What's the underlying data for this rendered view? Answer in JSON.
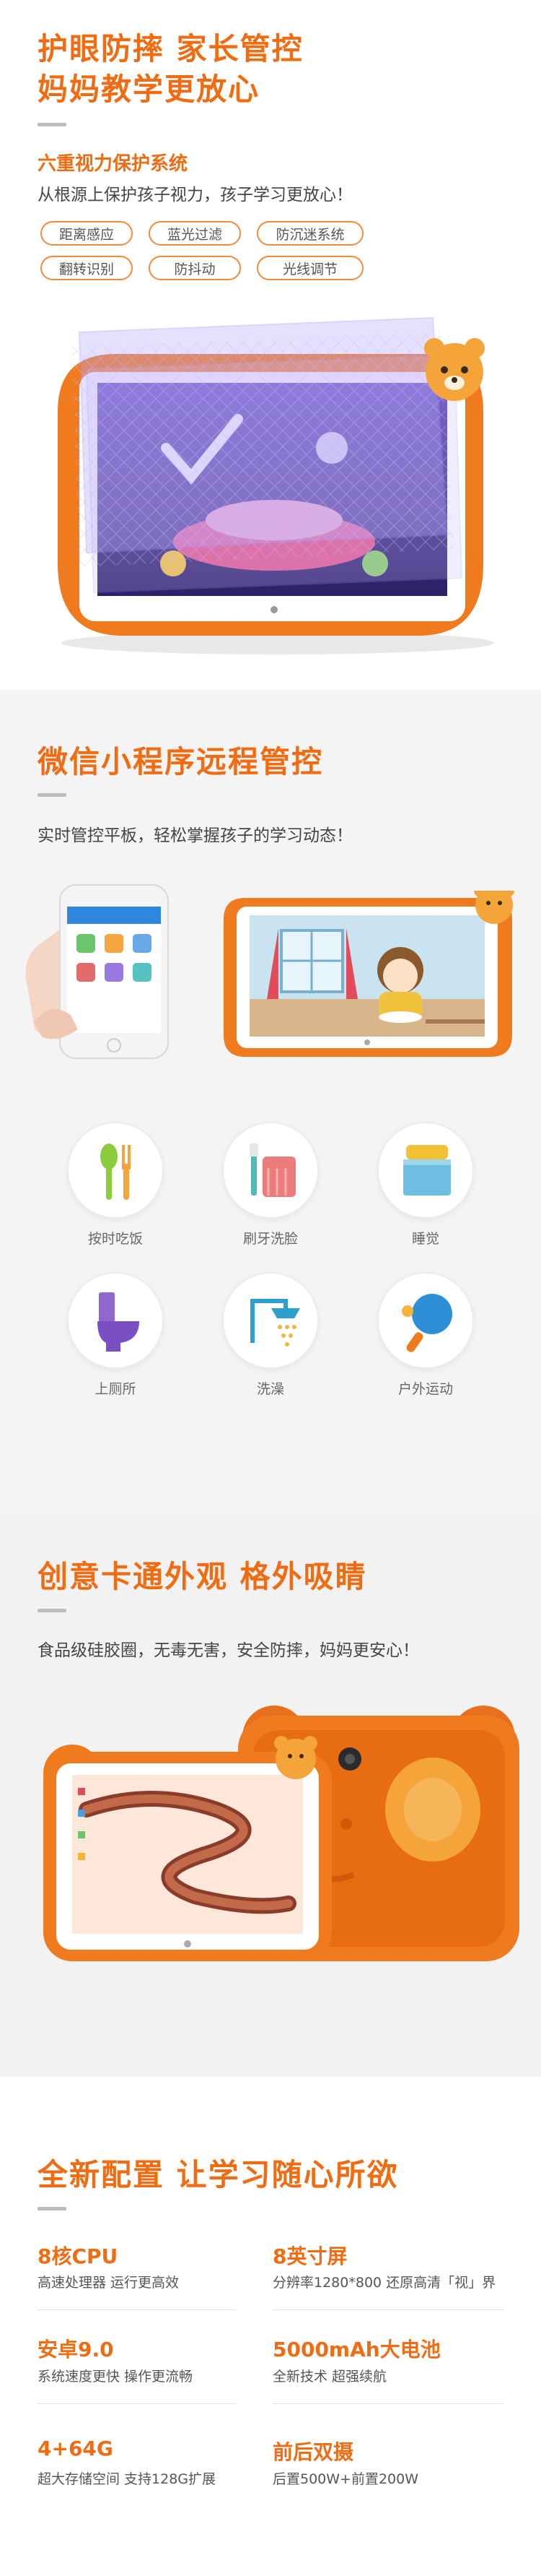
{
  "section1": {
    "title_line1": "护眼防摔 家长管控",
    "title_line2": "妈妈教学更放心",
    "subtitle": "六重视力保护系统",
    "description": "从根源上保护孩子视力，孩子学习更放心！",
    "tags": [
      "距离感应",
      "蓝光过滤",
      "防沉迷系统",
      "翻转识别",
      "防抖动",
      "光线调节"
    ]
  },
  "section2": {
    "title": "微信小程序远程管控",
    "description": "实时管控平板，轻松掌握孩子的学习动态！",
    "icons": [
      {
        "label": "按时吃饭",
        "icon": "spoon-fork-icon"
      },
      {
        "label": "刷牙洗脸",
        "icon": "toothbrush-icon"
      },
      {
        "label": "睡觉",
        "icon": "bed-icon"
      },
      {
        "label": "上厕所",
        "icon": "toilet-icon"
      },
      {
        "label": "洗澡",
        "icon": "shower-icon"
      },
      {
        "label": "户外运动",
        "icon": "ping-pong-icon"
      }
    ]
  },
  "section3": {
    "title": "创意卡通外观 格外吸睛",
    "description": "食品级硅胶圈，无毒无害，安全防摔，妈妈更安心！"
  },
  "section4": {
    "title": "全新配置 让学习随心所欲",
    "specs": [
      {
        "title": "8核CPU",
        "desc": "高速处理器 运行更高效"
      },
      {
        "title": "8英寸屏",
        "desc": "分辨率1280*800 还原高清「视」界"
      },
      {
        "title": "安卓9.0",
        "desc": "系统速度更快 操作更流畅"
      },
      {
        "title": "5000mAh大电池",
        "desc": "全新技术 超强续航"
      },
      {
        "title": "4+64G",
        "desc": "超大存储空间 支持128G扩展"
      },
      {
        "title": "前后双摄",
        "desc": "后置500W+前置200W"
      }
    ]
  },
  "colors": {
    "accent": "#f06c12",
    "tag_border": "#f28a3c",
    "bumper": "#f07a1e"
  }
}
